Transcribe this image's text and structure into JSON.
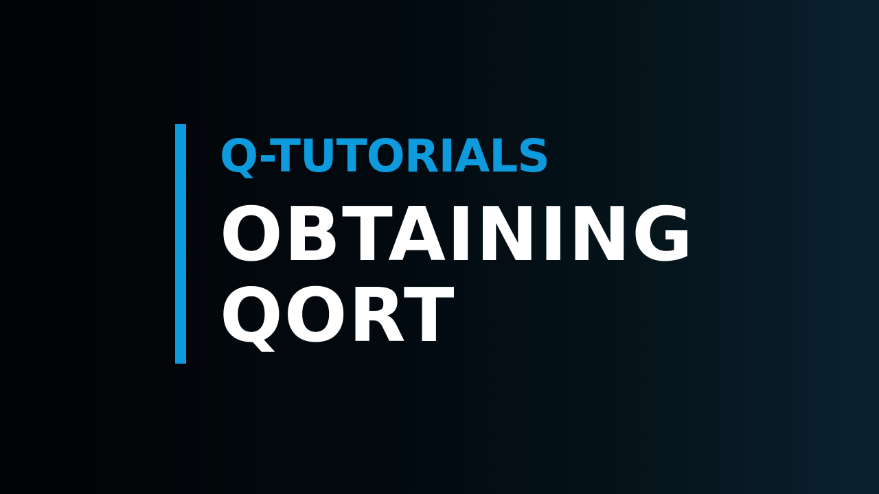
{
  "slide": {
    "subtitle": "Q-TUTORIALS",
    "title_line1": "OBTAINING",
    "title_line2": "QORT"
  },
  "colors": {
    "accent": "#0d9bdd",
    "title": "#ffffff",
    "background_dark": "#010304",
    "background_light": "#0a2230"
  }
}
